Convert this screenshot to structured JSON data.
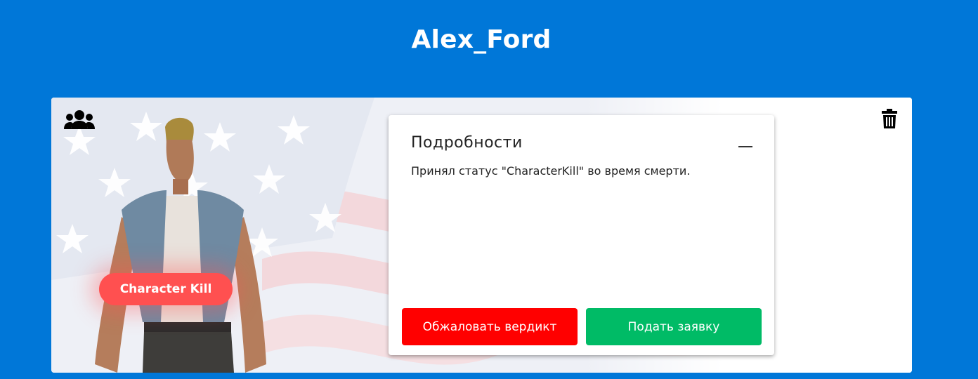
{
  "header": {
    "title": "Alex_Ford"
  },
  "card": {
    "badge": "Character Kill",
    "icons": {
      "group": "group-users-icon",
      "delete": "trash-icon"
    },
    "details": {
      "title": "Подробности",
      "text": "Принял статус \"CharacterKill\" во время смерти.",
      "collapse_icon": "minus-icon",
      "buttons": {
        "appeal": "Обжаловать вердикт",
        "submit": "Подать заявку"
      }
    }
  },
  "colors": {
    "background": "#0077d8",
    "badge": "#ff5050",
    "appeal_button": "#ff0000",
    "submit_button": "#00bb66"
  }
}
